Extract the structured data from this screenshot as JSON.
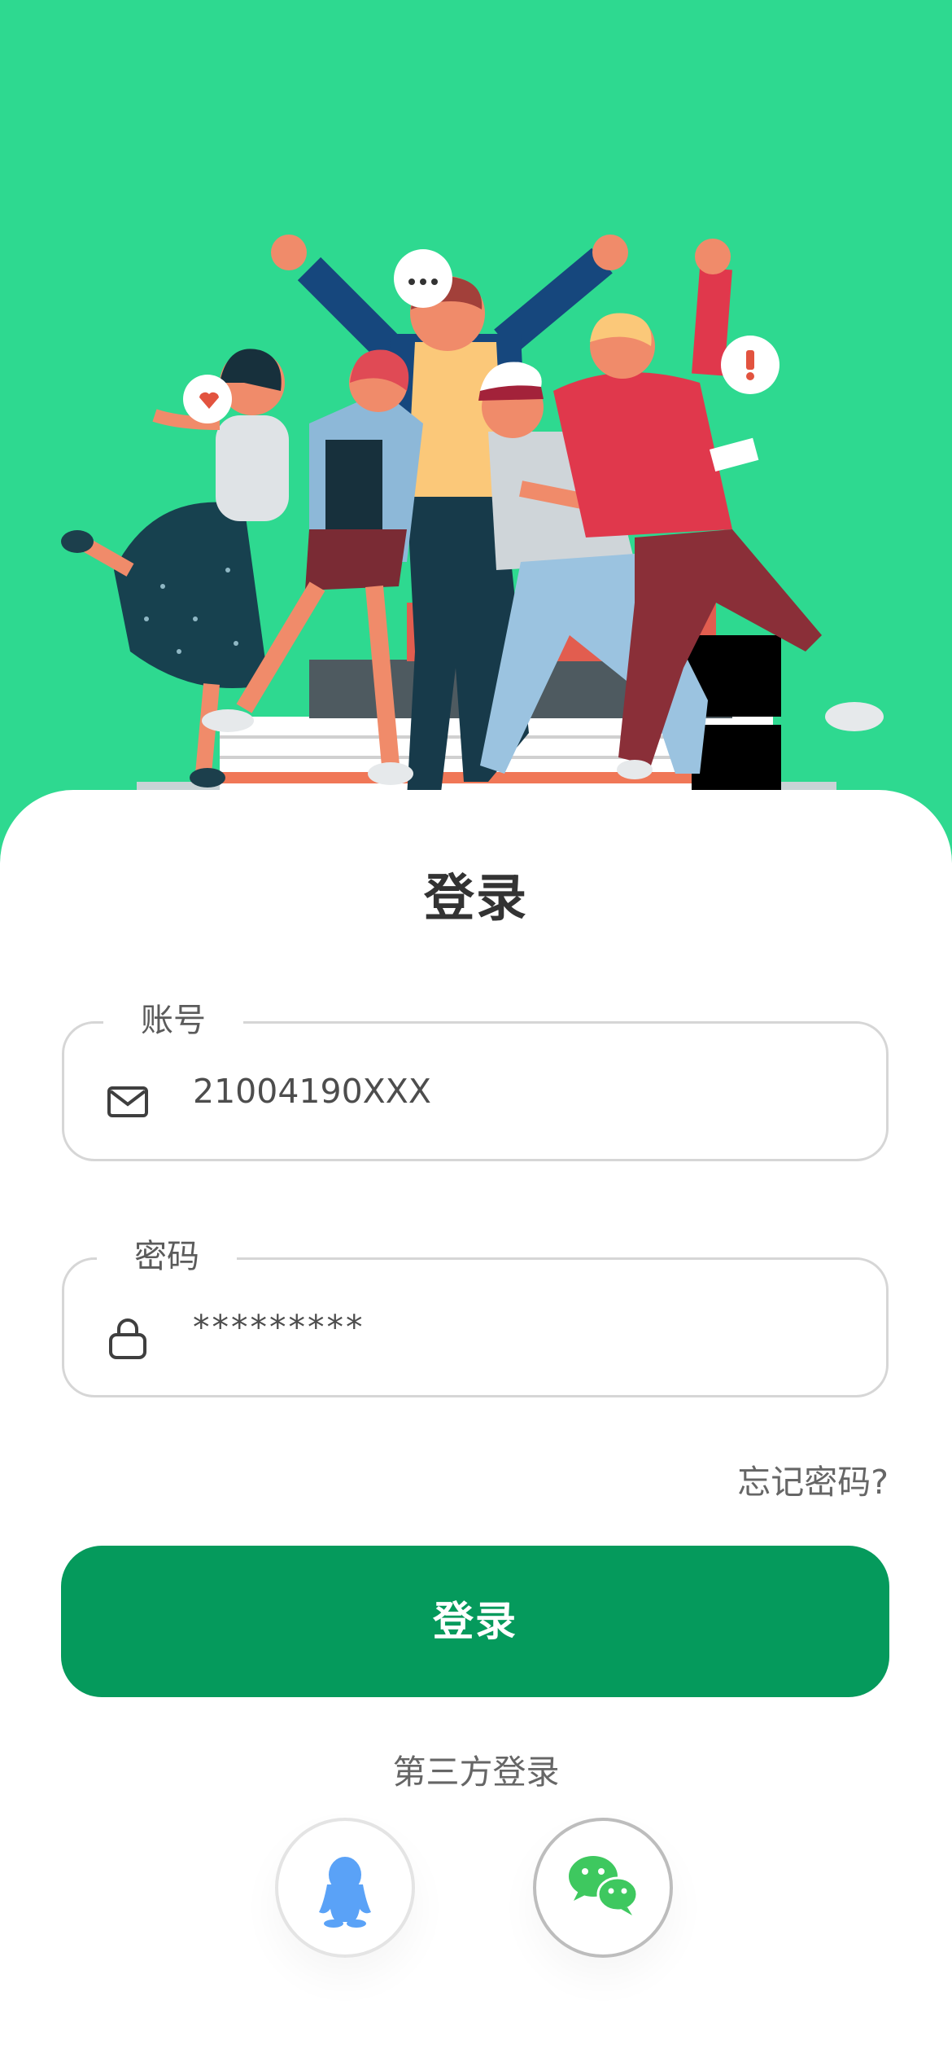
{
  "login": {
    "title": "登录",
    "account": {
      "label": "账号",
      "value": "21004190XXX",
      "icon": "mail-icon"
    },
    "password": {
      "label": "密码",
      "value": "*********",
      "icon": "lock-icon"
    },
    "forgot_password": "忘记密码?",
    "submit_label": "登录",
    "third_party": {
      "label": "第三方登录",
      "providers": [
        {
          "name": "qq",
          "icon": "qq-penguin-icon",
          "color": "#5aa2f7"
        },
        {
          "name": "wechat",
          "icon": "wechat-icon",
          "color": "#3ec85f"
        }
      ]
    }
  },
  "colors": {
    "hero_background": "#2ed990",
    "primary_button": "#059a5c",
    "text": "#333333"
  },
  "hero": {
    "illustration": "group-of-people-celebrating-illustration"
  }
}
